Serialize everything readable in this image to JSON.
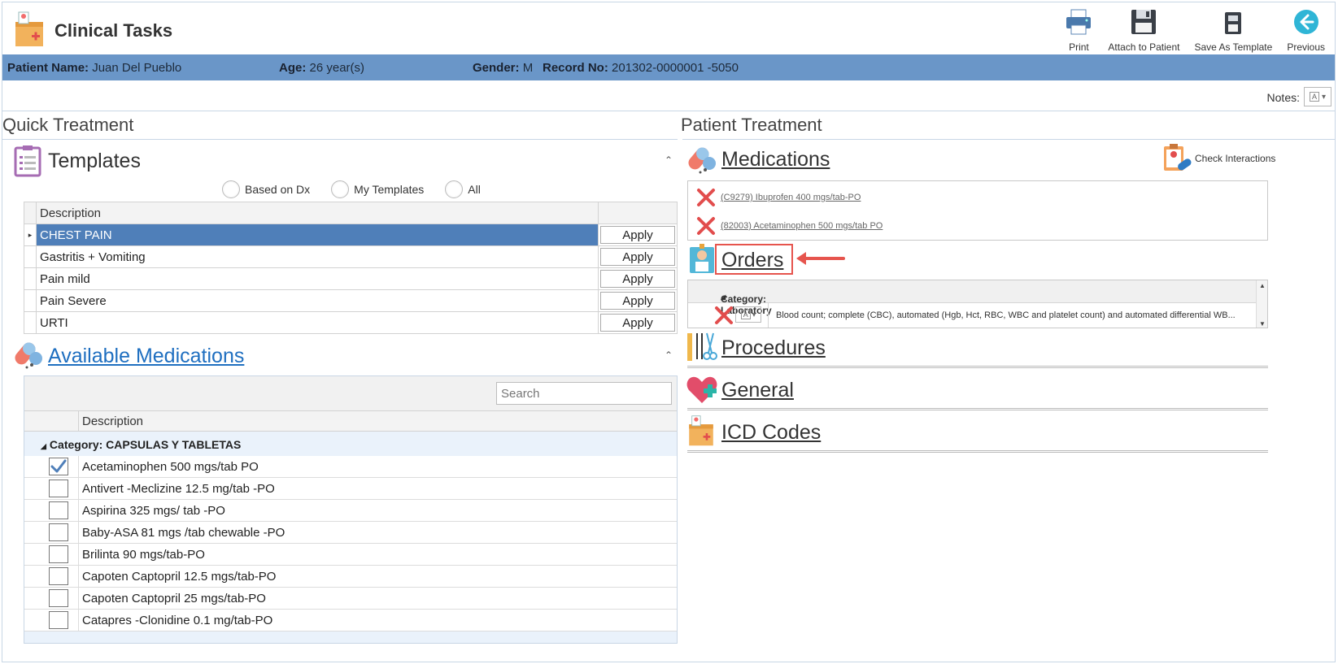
{
  "app": {
    "title": "Clinical Tasks"
  },
  "toolbar": {
    "print": "Print",
    "attach": "Attach to Patient",
    "save_template": "Save As Template",
    "previous": "Previous"
  },
  "patient": {
    "name_label": "Patient Name:",
    "name": "Juan Del Pueblo",
    "age_label": "Age:",
    "age": "26 year(s)",
    "gender_label": "Gender:",
    "gender": "M",
    "record_label": "Record No:",
    "record": "201302-0000001 -5050"
  },
  "notes": {
    "label": "Notes:"
  },
  "quick_treatment": {
    "title": "Quick Treatment",
    "templates": {
      "title": "Templates",
      "filters": [
        "Based on Dx",
        "My Templates",
        "All"
      ],
      "column": "Description",
      "apply_label": "Apply",
      "rows": [
        "CHEST PAIN",
        "Gastritis + Vomiting",
        "Pain mild",
        "Pain Severe",
        "URTI"
      ],
      "selected_index": 0
    },
    "available_meds": {
      "title": "Available Medications",
      "search_placeholder": "Search",
      "column": "Description",
      "category": "Category: CAPSULAS Y TABLETAS",
      "items": [
        {
          "label": "Acetaminophen 500 mgs/tab PO",
          "checked": true
        },
        {
          "label": "Antivert -Meclizine 12.5 mg/tab -PO",
          "checked": false
        },
        {
          "label": "Aspirina 325 mgs/ tab -PO",
          "checked": false
        },
        {
          "label": "Baby-ASA 81 mgs /tab chewable -PO",
          "checked": false
        },
        {
          "label": "Brilinta 90 mgs/tab-PO",
          "checked": false
        },
        {
          "label": "Capoten Captopril 12.5 mgs/tab-PO",
          "checked": false
        },
        {
          "label": "Capoten Captopril 25 mgs/tab-PO",
          "checked": false
        },
        {
          "label": "Catapres -Clonidine 0.1 mg/tab-PO",
          "checked": false
        }
      ]
    }
  },
  "patient_treatment": {
    "title": "Patient Treatment",
    "medications": {
      "title": "Medications",
      "check_interactions": "Check Interactions",
      "items": [
        "(C9279) Ibuprofen 400 mgs/tab-PO",
        "(82003) Acetaminophen 500 mgs/tab  PO"
      ]
    },
    "orders": {
      "title": "Orders",
      "category": "Category: Laboratory",
      "item": "Blood count; complete (CBC), automated (Hgb, Hct, RBC, WBC and platelet count) and automated differential WB..."
    },
    "procedures": {
      "title": "Procedures"
    },
    "general": {
      "title": "General"
    },
    "icd": {
      "title": "ICD Codes"
    }
  },
  "colors": {
    "patient_bar": "#6a96c8",
    "selected_row": "#4f7fb9",
    "highlight": "#e6544d",
    "link": "#1f6fc0"
  }
}
